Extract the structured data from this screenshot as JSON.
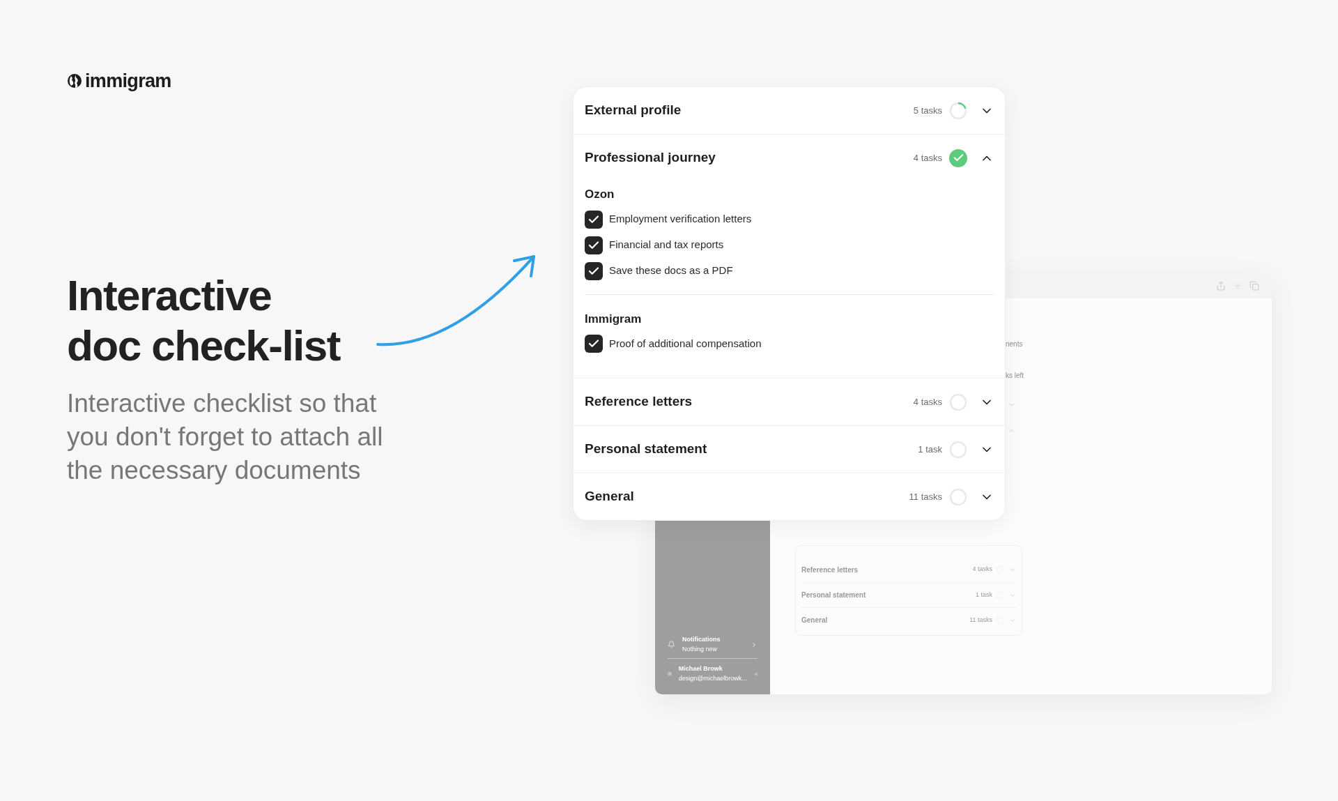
{
  "brand": {
    "name": "immigram"
  },
  "headline": {
    "title": "Interactive doc check-list",
    "subtitle": "Interactive checklist so that you don't forget to attach all the necessary documents"
  },
  "checklist": {
    "sections": [
      {
        "title": "External profile",
        "count": "5 tasks",
        "complete": false,
        "level": 0.2,
        "expanded": false
      },
      {
        "title": "Professional journey",
        "count": "4 tasks",
        "complete": true,
        "expanded": true,
        "groups": [
          {
            "name": "Ozon",
            "items": [
              {
                "label": "Employment verification letters",
                "checked": true
              },
              {
                "label": "Financial and tax reports",
                "checked": true
              },
              {
                "label": "Save these docs as a PDF",
                "checked": true
              }
            ]
          },
          {
            "name": "Immigram",
            "items": [
              {
                "label": "Proof of additional compensation",
                "checked": true
              }
            ]
          }
        ]
      },
      {
        "title": "Reference letters",
        "count": "4 tasks",
        "complete": false,
        "level": 0,
        "expanded": false
      },
      {
        "title": "Personal statement",
        "count": "1 task",
        "complete": false,
        "level": 0,
        "expanded": false
      },
      {
        "title": "General",
        "count": "11 tasks",
        "complete": false,
        "level": 0,
        "expanded": false
      }
    ]
  },
  "background_window": {
    "partial_texts": [
      "nents",
      "ks left"
    ],
    "sections": [
      {
        "title": "Reference letters",
        "count": "4 tasks"
      },
      {
        "title": "Personal statement",
        "count": "1 task"
      },
      {
        "title": "General",
        "count": "11 tasks"
      }
    ],
    "sidebar": {
      "notifications": {
        "title": "Notifications",
        "subtitle": "Nothing new"
      },
      "user": {
        "name": "Michael Browk",
        "email": "design@michaelbrowk..."
      }
    }
  }
}
